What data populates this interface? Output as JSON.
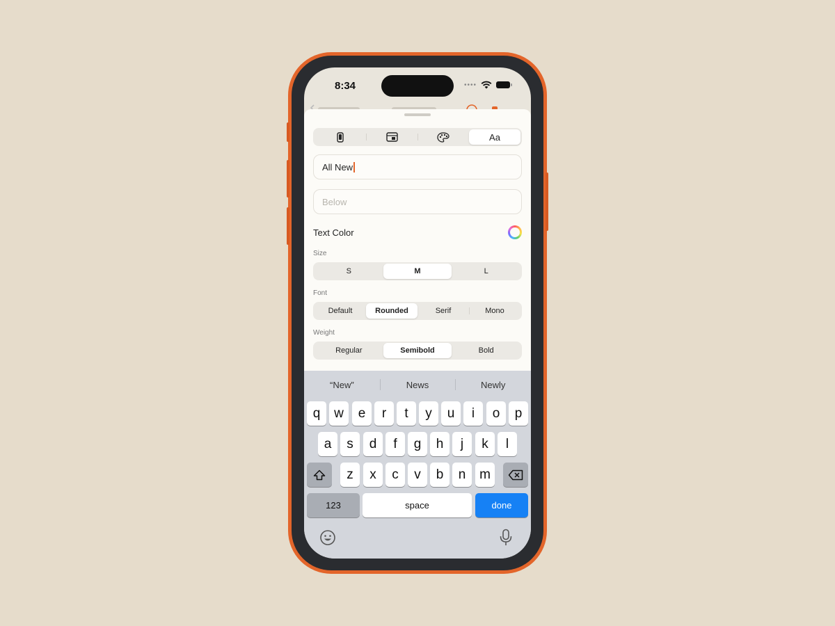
{
  "status": {
    "time": "8:34"
  },
  "tabs": [
    {
      "name": "phone-icon",
      "label": ""
    },
    {
      "name": "layout-icon",
      "label": ""
    },
    {
      "name": "palette-icon",
      "label": ""
    },
    {
      "name": "text-style-tab",
      "label": "Aa"
    }
  ],
  "title_field": {
    "value": "All New"
  },
  "subtitle_field": {
    "placeholder": "Below"
  },
  "text_color": {
    "label": "Text Color"
  },
  "size": {
    "label": "Size",
    "options": [
      "S",
      "M",
      "L"
    ],
    "selected": "M"
  },
  "font": {
    "label": "Font",
    "options": [
      "Default",
      "Rounded",
      "Serif",
      "Mono"
    ],
    "selected": "Rounded"
  },
  "weight": {
    "label": "Weight",
    "options": [
      "Regular",
      "Semibold",
      "Bold"
    ],
    "selected": "Semibold"
  },
  "suggestions": [
    "“New”",
    "News",
    "Newly"
  ],
  "keys": {
    "row1": [
      "q",
      "w",
      "e",
      "r",
      "t",
      "y",
      "u",
      "i",
      "o",
      "p"
    ],
    "row2": [
      "a",
      "s",
      "d",
      "f",
      "g",
      "h",
      "j",
      "k",
      "l"
    ],
    "row3": [
      "z",
      "x",
      "c",
      "v",
      "b",
      "n",
      "m"
    ],
    "numbers": "123",
    "space": "space",
    "done": "done"
  },
  "colors": {
    "accent": "#e3652a",
    "done": "#1681f5"
  }
}
